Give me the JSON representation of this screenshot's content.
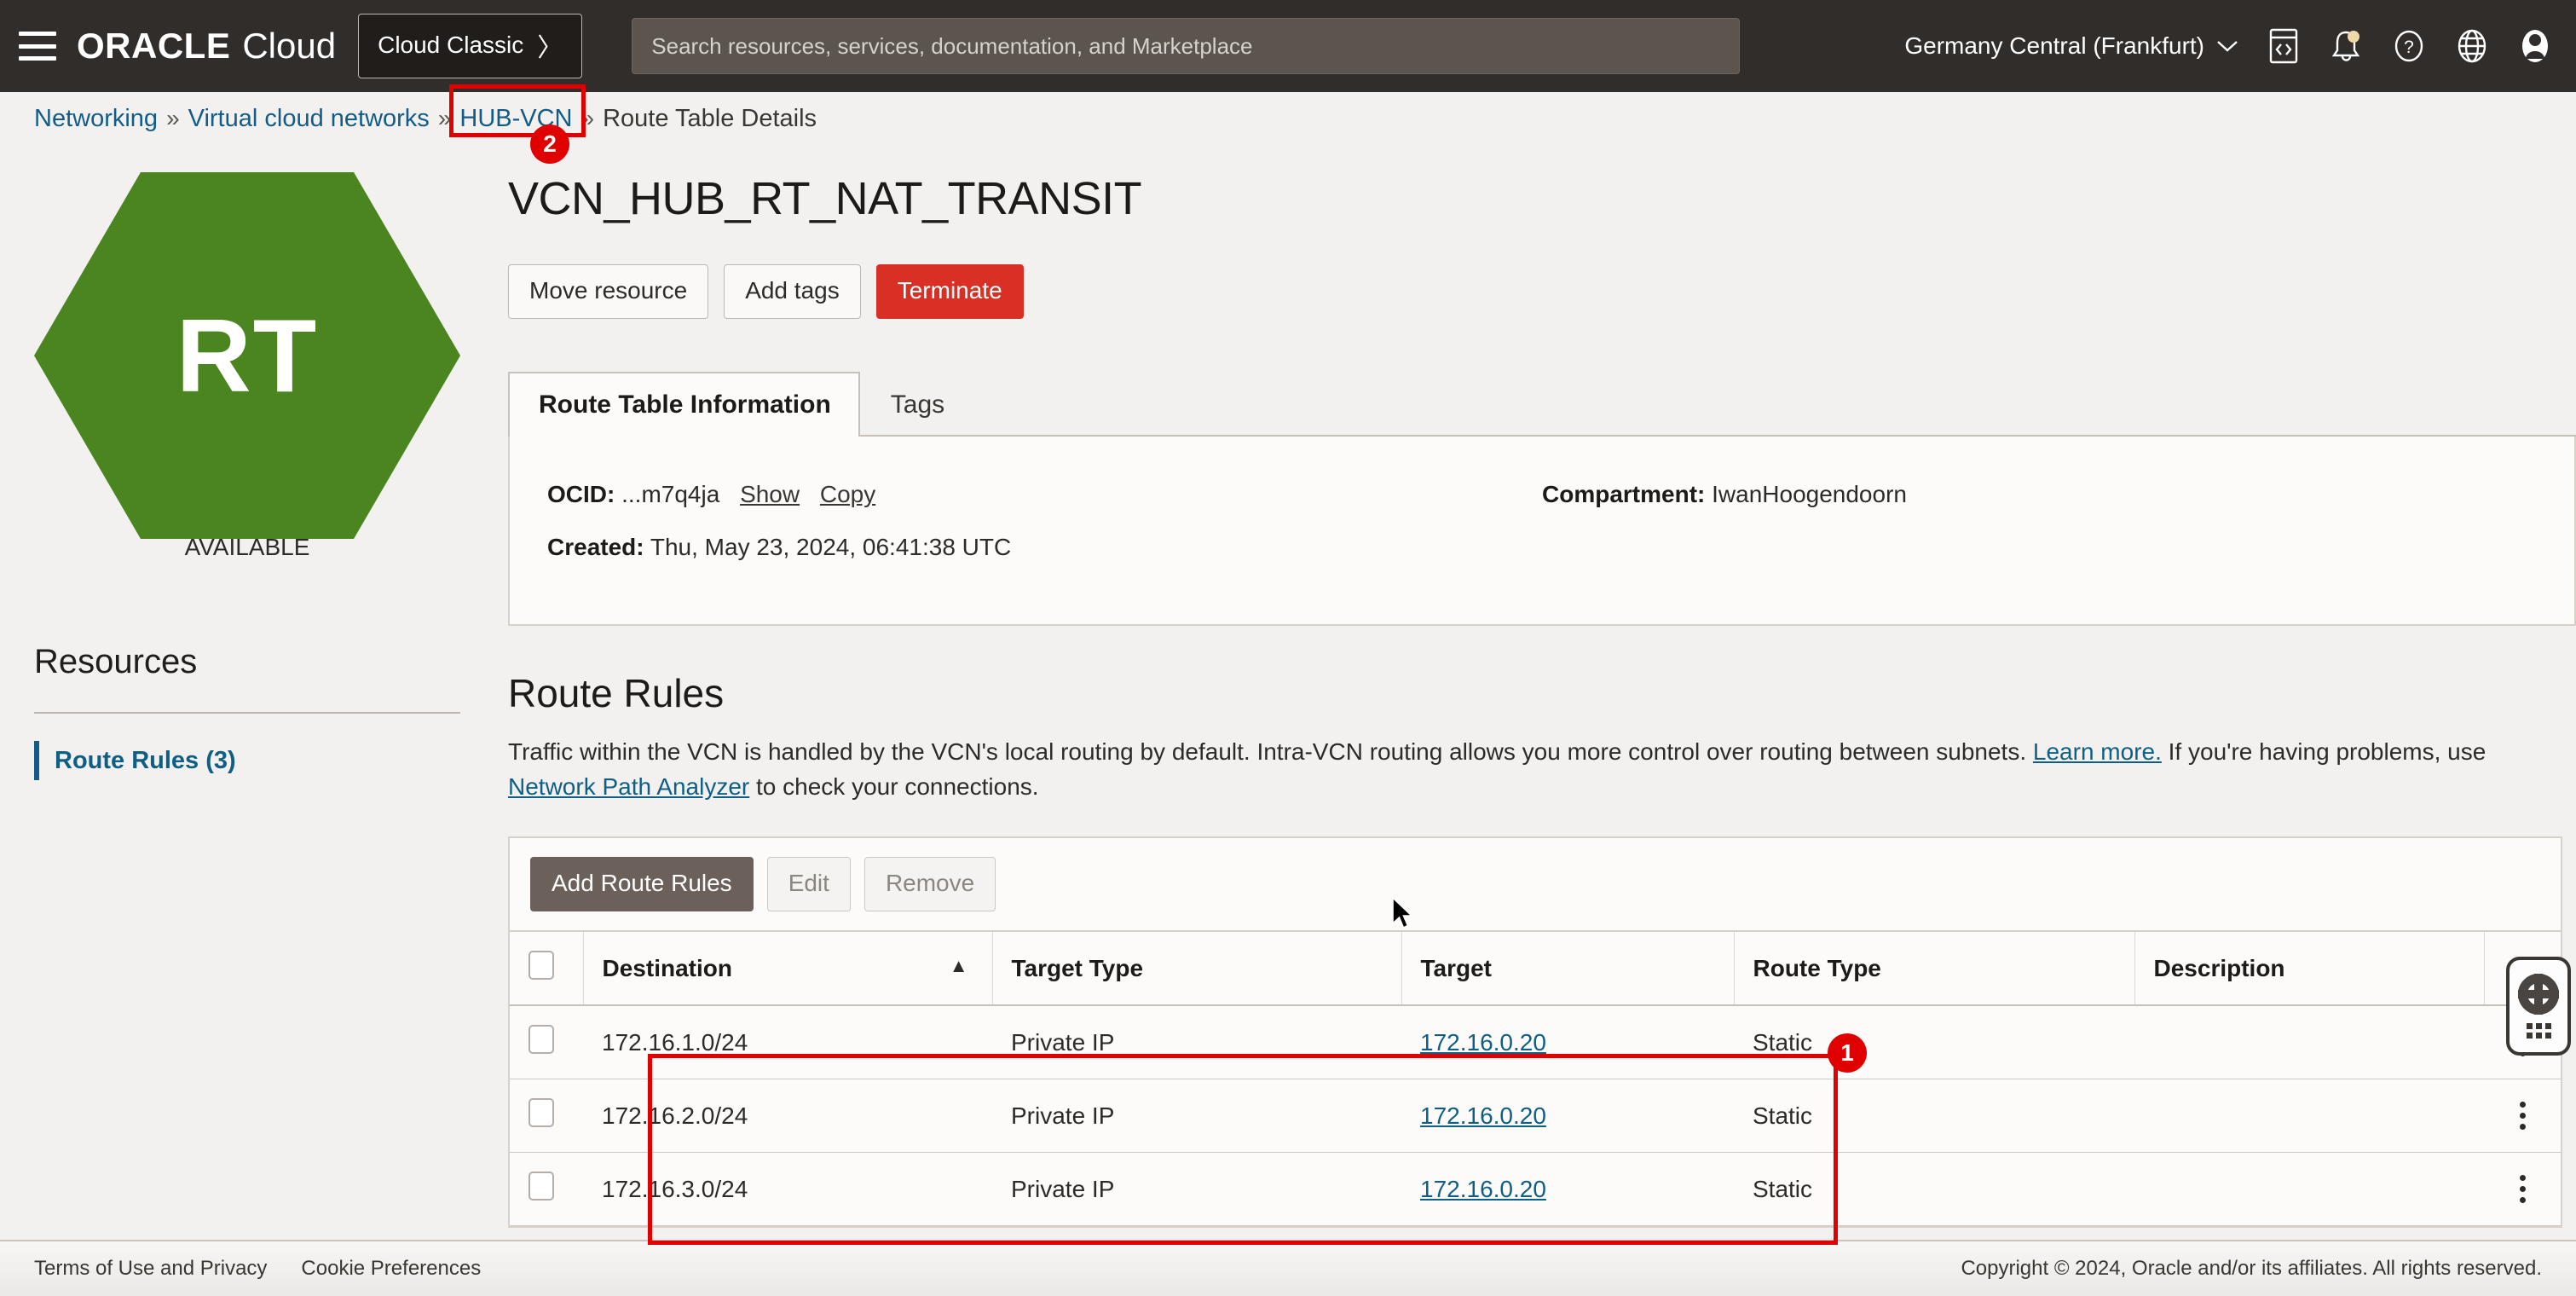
{
  "topbar": {
    "menu_icon": "hamburger-icon",
    "brand_oracle": "ORACLE",
    "brand_cloud": "Cloud",
    "cloud_classic_label": "Cloud Classic",
    "cloud_classic_chevron": "〉",
    "search_placeholder": "Search resources, services, documentation, and Marketplace",
    "search_value": "",
    "region": "Germany Central (Frankfurt)",
    "region_caret": "⌄",
    "icons": [
      "code-editor-icon",
      "notifications-bell-icon",
      "help-question-icon",
      "language-globe-icon",
      "user-avatar-icon"
    ]
  },
  "breadcrumb": {
    "items": [
      {
        "label": "Networking",
        "link": true
      },
      {
        "label": "Virtual cloud networks",
        "link": true
      },
      {
        "label": "HUB-VCN",
        "link": true,
        "highlighted": true
      },
      {
        "label": "Route Table Details",
        "link": false
      }
    ],
    "separator": "»"
  },
  "annotations": [
    {
      "number": "1",
      "target": "route-rules-rows"
    },
    {
      "number": "2",
      "target": "breadcrumb-hub-vcn"
    }
  ],
  "sidebar": {
    "resource_badge": "RT",
    "resource_badge_color": "#4a8520",
    "status": "AVAILABLE",
    "resources_title": "Resources",
    "items": [
      {
        "label": "Route Rules (3)",
        "active": true
      }
    ]
  },
  "main": {
    "page_title": "VCN_HUB_RT_NAT_TRANSIT",
    "actions": [
      {
        "label": "Move resource",
        "style": "default"
      },
      {
        "label": "Add tags",
        "style": "default"
      },
      {
        "label": "Terminate",
        "style": "danger"
      }
    ],
    "tabs": [
      {
        "label": "Route Table Information",
        "active": true
      },
      {
        "label": "Tags",
        "active": false
      }
    ],
    "info": {
      "ocid_label": "OCID:",
      "ocid_value": "...m7q4ja",
      "ocid_show": "Show",
      "ocid_copy": "Copy",
      "created_label": "Created:",
      "created_value": "Thu, May 23, 2024, 06:41:38 UTC",
      "compartment_label": "Compartment:",
      "compartment_value": "IwanHoogendoorn"
    },
    "section": {
      "title": "Route Rules",
      "desc_part1": "Traffic within the VCN is handled by the VCN's local routing by default. Intra-VCN routing allows you more control over routing between subnets.",
      "desc_link1": "Learn more.",
      "desc_part2": "If you're having problems, use",
      "desc_link2": "Network Path Analyzer",
      "desc_part3": "to check your connections."
    },
    "table_toolbar": [
      {
        "label": "Add Route Rules",
        "style": "primary"
      },
      {
        "label": "Edit",
        "style": "disabled"
      },
      {
        "label": "Remove",
        "style": "disabled"
      }
    ],
    "table": {
      "columns": [
        "Destination",
        "Target Type",
        "Target",
        "Route Type",
        "Description"
      ],
      "sort_column": "Destination",
      "sort_direction": "▲",
      "rows": [
        {
          "destination": "172.16.1.0/24",
          "target_type": "Private IP",
          "target": "172.16.0.20",
          "route_type": "Static",
          "description": ""
        },
        {
          "destination": "172.16.2.0/24",
          "target_type": "Private IP",
          "target": "172.16.0.20",
          "route_type": "Static",
          "description": ""
        },
        {
          "destination": "172.16.3.0/24",
          "target_type": "Private IP",
          "target": "172.16.0.20",
          "route_type": "Static",
          "description": ""
        }
      ]
    }
  },
  "footer": {
    "terms": "Terms of Use and Privacy",
    "cookies": "Cookie Preferences",
    "copyright": "Copyright © 2024, Oracle and/or its affiliates. All rights reserved."
  }
}
